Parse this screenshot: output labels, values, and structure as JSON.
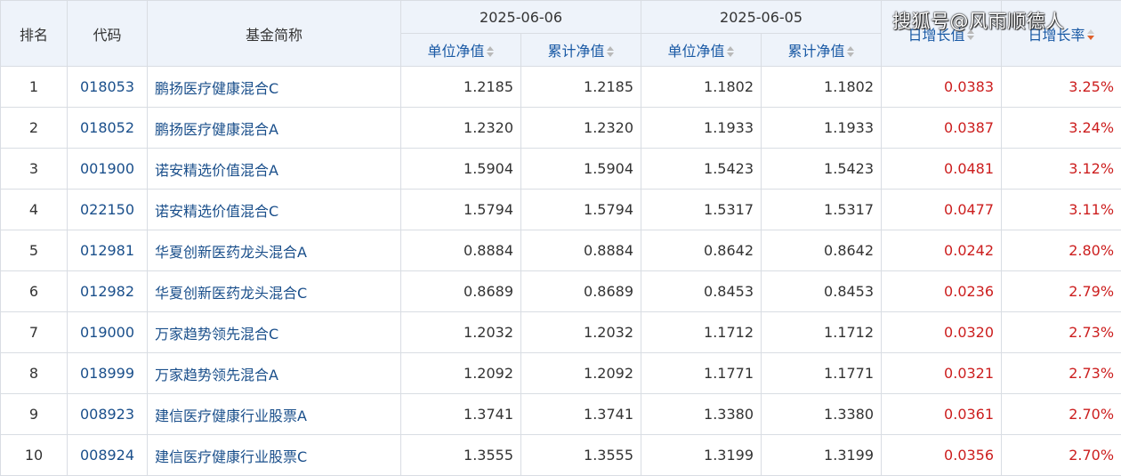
{
  "headers": {
    "rank": "排名",
    "code": "代码",
    "name": "基金简称",
    "date1": "2025-06-06",
    "date2": "2025-06-05",
    "unit_nav": "单位净值",
    "acc_nav": "累计净值",
    "growth_value": "日增长值",
    "growth_rate": "日增长率"
  },
  "watermark": "搜狐号@风雨顺德人",
  "colors": {
    "header_bg": "#eef3fa",
    "link": "#1a4f8b",
    "positive": "#cc1e1e",
    "sort_active": "#e0602b"
  },
  "rows": [
    {
      "rank": "1",
      "code": "018053",
      "name": "鹏扬医疗健康混合C",
      "unit1": "1.2185",
      "acc1": "1.2185",
      "unit2": "1.1802",
      "acc2": "1.1802",
      "gv": "0.0383",
      "gr": "3.25%"
    },
    {
      "rank": "2",
      "code": "018052",
      "name": "鹏扬医疗健康混合A",
      "unit1": "1.2320",
      "acc1": "1.2320",
      "unit2": "1.1933",
      "acc2": "1.1933",
      "gv": "0.0387",
      "gr": "3.24%"
    },
    {
      "rank": "3",
      "code": "001900",
      "name": "诺安精选价值混合A",
      "unit1": "1.5904",
      "acc1": "1.5904",
      "unit2": "1.5423",
      "acc2": "1.5423",
      "gv": "0.0481",
      "gr": "3.12%"
    },
    {
      "rank": "4",
      "code": "022150",
      "name": "诺安精选价值混合C",
      "unit1": "1.5794",
      "acc1": "1.5794",
      "unit2": "1.5317",
      "acc2": "1.5317",
      "gv": "0.0477",
      "gr": "3.11%"
    },
    {
      "rank": "5",
      "code": "012981",
      "name": "华夏创新医药龙头混合A",
      "unit1": "0.8884",
      "acc1": "0.8884",
      "unit2": "0.8642",
      "acc2": "0.8642",
      "gv": "0.0242",
      "gr": "2.80%"
    },
    {
      "rank": "6",
      "code": "012982",
      "name": "华夏创新医药龙头混合C",
      "unit1": "0.8689",
      "acc1": "0.8689",
      "unit2": "0.8453",
      "acc2": "0.8453",
      "gv": "0.0236",
      "gr": "2.79%"
    },
    {
      "rank": "7",
      "code": "019000",
      "name": "万家趋势领先混合C",
      "unit1": "1.2032",
      "acc1": "1.2032",
      "unit2": "1.1712",
      "acc2": "1.1712",
      "gv": "0.0320",
      "gr": "2.73%"
    },
    {
      "rank": "8",
      "code": "018999",
      "name": "万家趋势领先混合A",
      "unit1": "1.2092",
      "acc1": "1.2092",
      "unit2": "1.1771",
      "acc2": "1.1771",
      "gv": "0.0321",
      "gr": "2.73%"
    },
    {
      "rank": "9",
      "code": "008923",
      "name": "建信医疗健康行业股票A",
      "unit1": "1.3741",
      "acc1": "1.3741",
      "unit2": "1.3380",
      "acc2": "1.3380",
      "gv": "0.0361",
      "gr": "2.70%"
    },
    {
      "rank": "10",
      "code": "008924",
      "name": "建信医疗健康行业股票C",
      "unit1": "1.3555",
      "acc1": "1.3555",
      "unit2": "1.3199",
      "acc2": "1.3199",
      "gv": "0.0356",
      "gr": "2.70%"
    }
  ]
}
